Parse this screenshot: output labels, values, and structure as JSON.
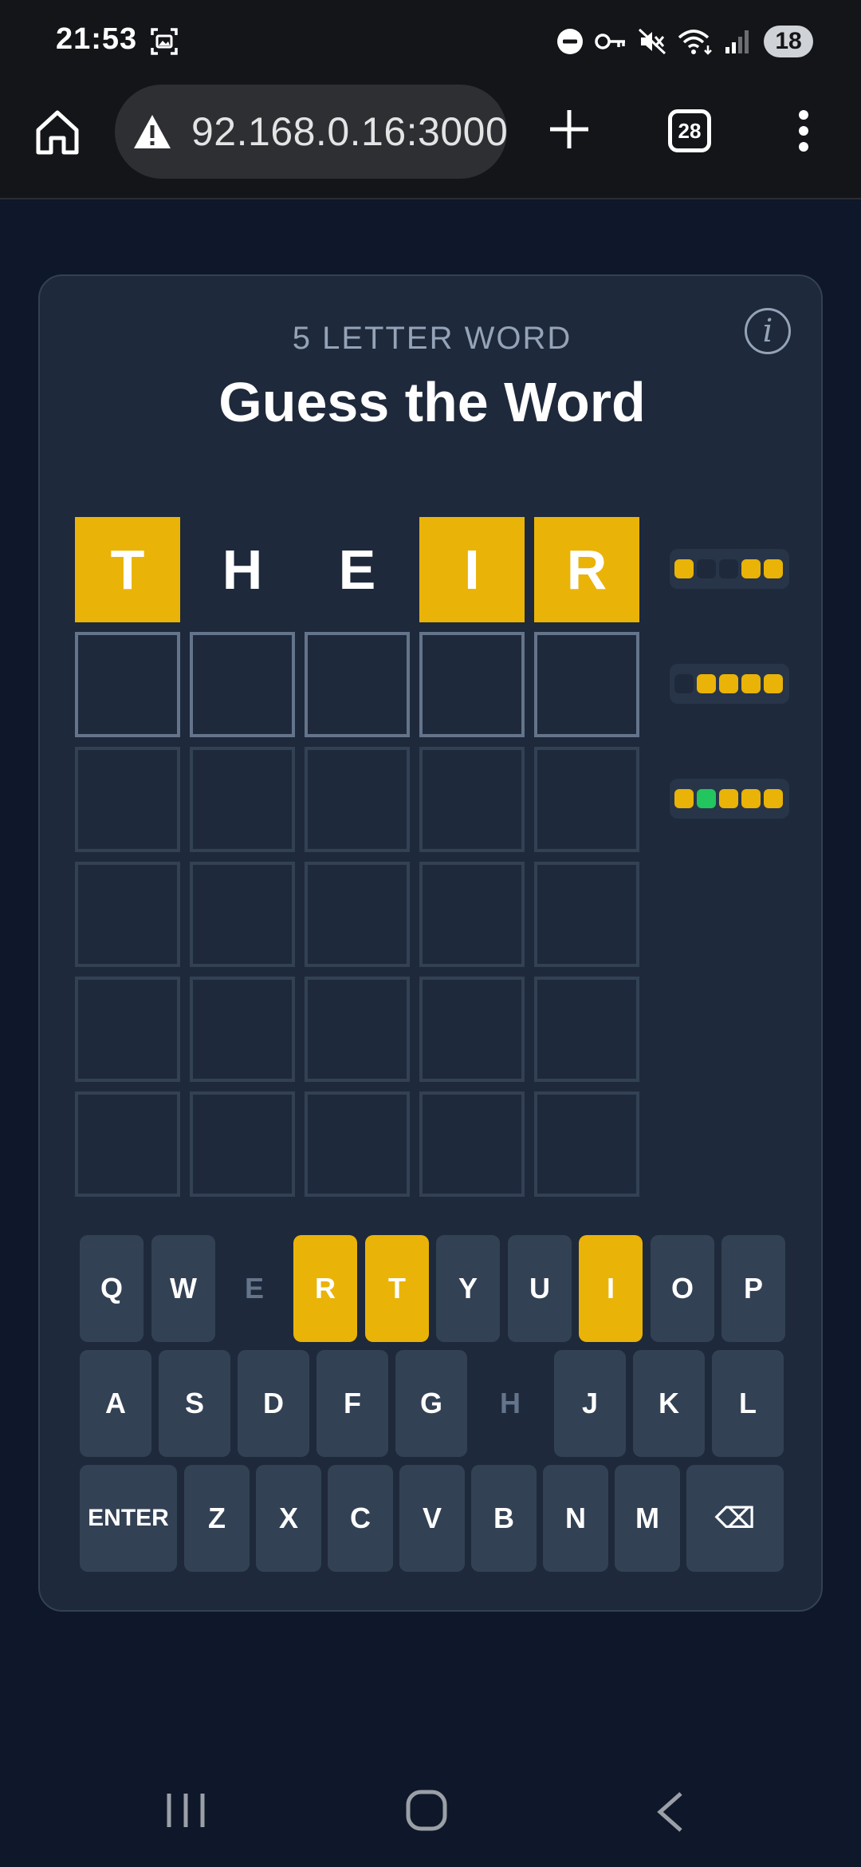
{
  "status_bar": {
    "time": "21:53",
    "battery": "18",
    "icons": [
      "screenshot-icon",
      "dnd-icon",
      "vpn-key-icon",
      "mute-icon",
      "wifi-icon",
      "signal-icon"
    ]
  },
  "browser": {
    "url": "92.168.0.16:3000",
    "tab_count": "28",
    "icons": [
      "home-icon",
      "warning-icon",
      "plus-icon",
      "menu-icon"
    ]
  },
  "game": {
    "subtitle": "5 LETTER WORD",
    "title": "Guess the Word",
    "info_label": "i",
    "rows": [
      {
        "letters": [
          "T",
          "H",
          "E",
          "I",
          "R"
        ],
        "states": [
          "present",
          "absent",
          "absent",
          "present",
          "present"
        ]
      },
      {
        "letters": [
          "",
          "",
          "",
          "",
          ""
        ],
        "states": [
          "active",
          "active",
          "active",
          "active",
          "active"
        ]
      },
      {
        "letters": [
          "",
          "",
          "",
          "",
          ""
        ],
        "states": [
          "empty",
          "empty",
          "empty",
          "empty",
          "empty"
        ]
      },
      {
        "letters": [
          "",
          "",
          "",
          "",
          ""
        ],
        "states": [
          "empty",
          "empty",
          "empty",
          "empty",
          "empty"
        ]
      },
      {
        "letters": [
          "",
          "",
          "",
          "",
          ""
        ],
        "states": [
          "empty",
          "empty",
          "empty",
          "empty",
          "empty"
        ]
      },
      {
        "letters": [
          "",
          "",
          "",
          "",
          ""
        ],
        "states": [
          "empty",
          "empty",
          "empty",
          "empty",
          "empty"
        ]
      }
    ],
    "hints": [
      [
        "y",
        "n",
        "n",
        "y",
        "y"
      ],
      [
        "n",
        "y",
        "y",
        "y",
        "y"
      ],
      [
        "y",
        "g",
        "y",
        "y",
        "y"
      ]
    ],
    "colors": {
      "present": "#eab308",
      "correct": "#22c55e",
      "key": "#334155",
      "card": "#1e293b",
      "background": "#0f172a"
    }
  },
  "keyboard": {
    "rows": [
      [
        {
          "label": "Q",
          "state": "unused"
        },
        {
          "label": "W",
          "state": "unused"
        },
        {
          "label": "E",
          "state": "absent"
        },
        {
          "label": "R",
          "state": "present"
        },
        {
          "label": "T",
          "state": "present"
        },
        {
          "label": "Y",
          "state": "unused"
        },
        {
          "label": "U",
          "state": "unused"
        },
        {
          "label": "I",
          "state": "present"
        },
        {
          "label": "O",
          "state": "unused"
        },
        {
          "label": "P",
          "state": "unused"
        }
      ],
      [
        {
          "label": "A",
          "state": "unused"
        },
        {
          "label": "S",
          "state": "unused"
        },
        {
          "label": "D",
          "state": "unused"
        },
        {
          "label": "F",
          "state": "unused"
        },
        {
          "label": "G",
          "state": "unused"
        },
        {
          "label": "H",
          "state": "absent"
        },
        {
          "label": "J",
          "state": "unused"
        },
        {
          "label": "K",
          "state": "unused"
        },
        {
          "label": "L",
          "state": "unused"
        }
      ],
      [
        {
          "label": "ENTER",
          "state": "unused"
        },
        {
          "label": "Z",
          "state": "unused"
        },
        {
          "label": "X",
          "state": "unused"
        },
        {
          "label": "C",
          "state": "unused"
        },
        {
          "label": "V",
          "state": "unused"
        },
        {
          "label": "B",
          "state": "unused"
        },
        {
          "label": "N",
          "state": "unused"
        },
        {
          "label": "M",
          "state": "unused"
        },
        {
          "label": "⌫",
          "state": "unused"
        }
      ]
    ]
  },
  "nav": {
    "icons": [
      "recent-apps-icon",
      "home-circle-icon",
      "back-icon"
    ]
  }
}
